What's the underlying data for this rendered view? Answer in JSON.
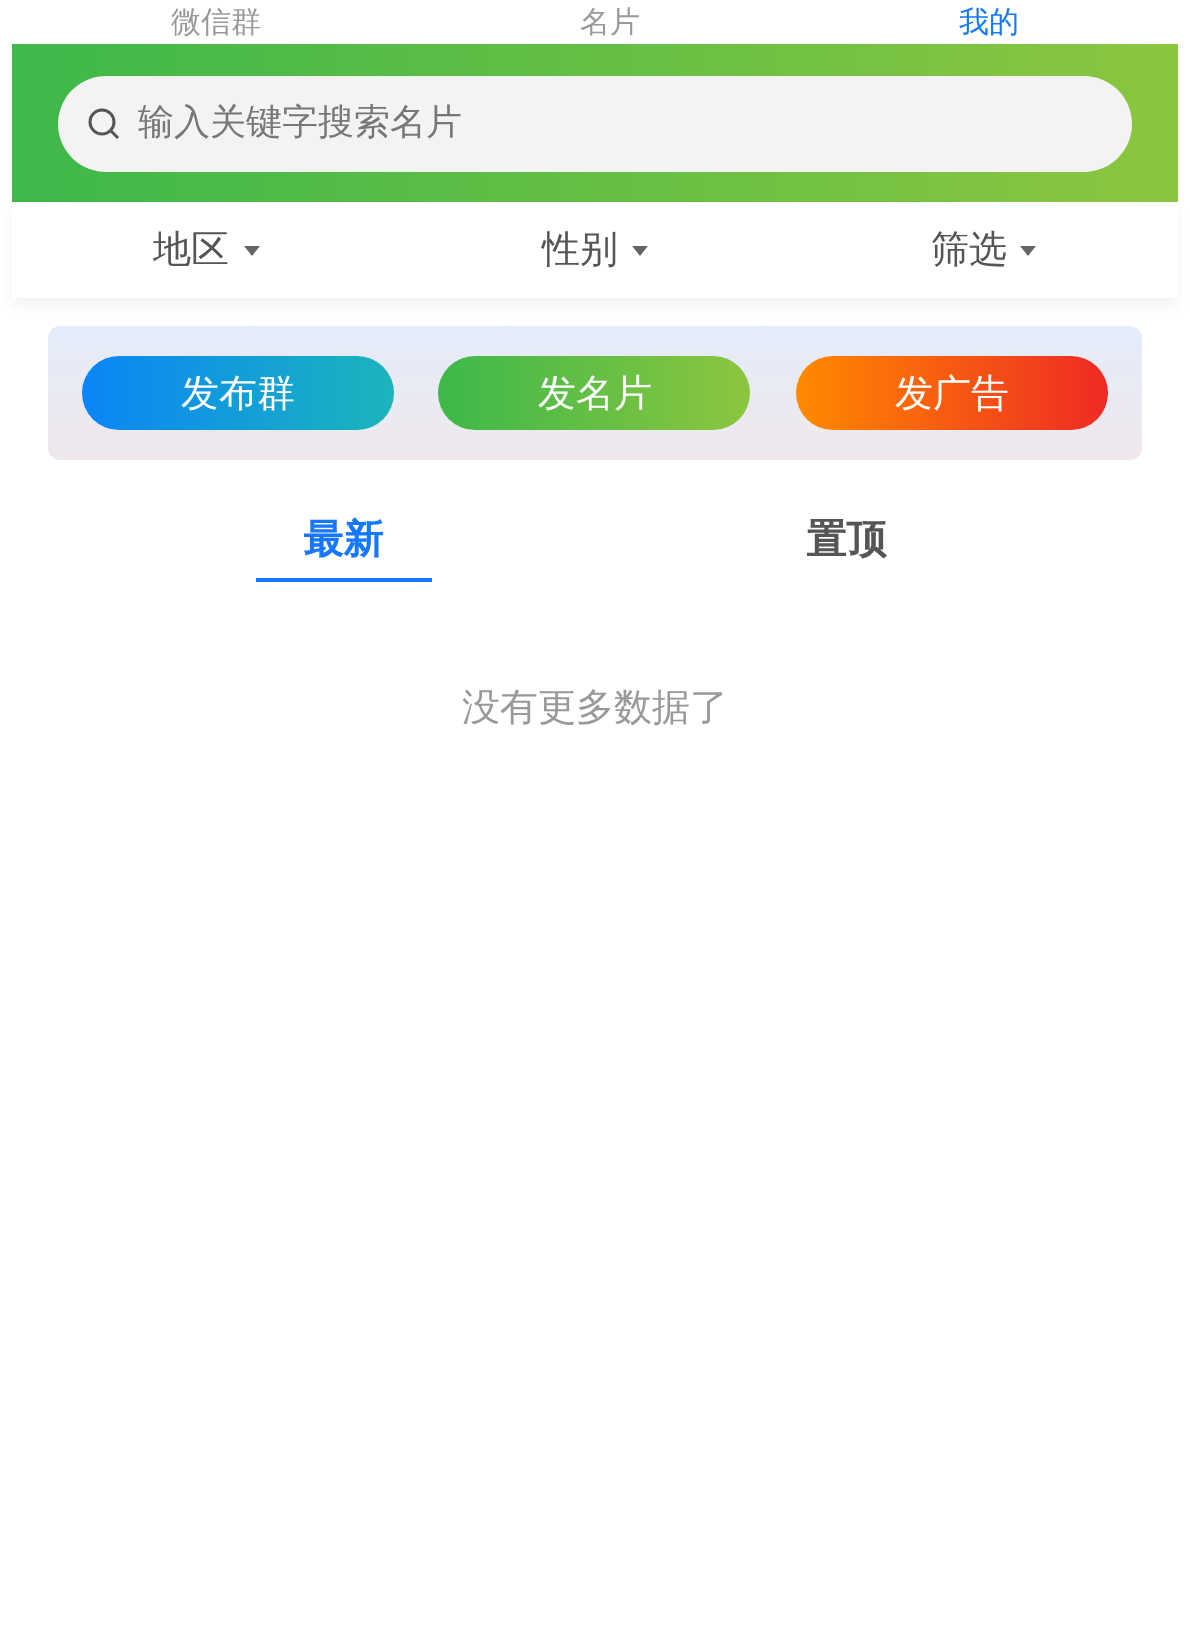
{
  "nav_tabs": [
    {
      "label": "微信群",
      "selected": false
    },
    {
      "label": "名片",
      "selected": false
    },
    {
      "label": "我的",
      "selected": true
    }
  ],
  "search": {
    "placeholder": "输入关键字搜索名片"
  },
  "filters": [
    {
      "label": "地区"
    },
    {
      "label": "性别"
    },
    {
      "label": "筛选"
    }
  ],
  "actions": [
    {
      "label": "发布群",
      "kind": "group"
    },
    {
      "label": "发名片",
      "kind": "card"
    },
    {
      "label": "发广告",
      "kind": "ad"
    }
  ],
  "list_tabs": [
    {
      "label": "最新",
      "selected": true
    },
    {
      "label": "置顶",
      "selected": false
    }
  ],
  "empty_message": "没有更多数据了"
}
